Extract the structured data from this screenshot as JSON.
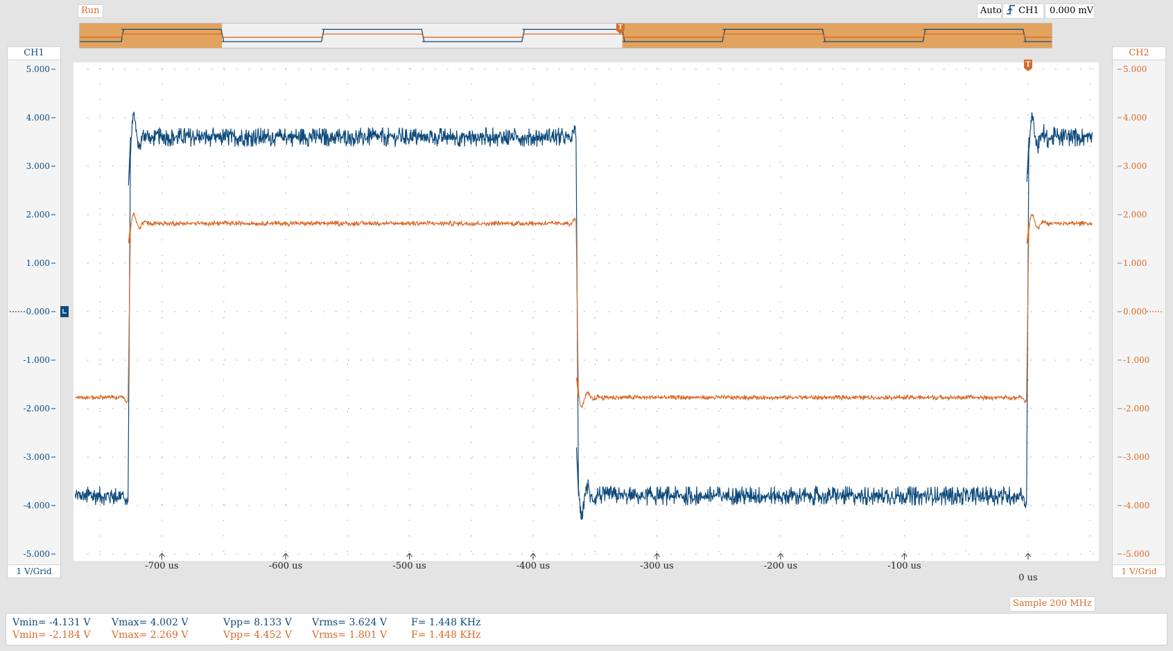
{
  "header": {
    "run_label": "Run",
    "trigger_mode": "Auto",
    "trigger_source": "CH1",
    "trigger_level": "0.000 mV",
    "trigger_marker": "T"
  },
  "ch1": {
    "name": "CH1",
    "scale": "1 V/Grid",
    "color": "#0e4a7c"
  },
  "ch2": {
    "name": "CH2",
    "scale": "1 V/Grid",
    "color": "#d86a2a"
  },
  "footer": {
    "sample_rate": "Sample 200 MHz"
  },
  "chart_data": {
    "type": "line",
    "title": "",
    "xlabel": "",
    "ylabel": "",
    "x_unit": "us",
    "xlim": [
      -770,
      50
    ],
    "ylim": [
      -5,
      5
    ],
    "x_ticks": [
      -700,
      -600,
      -500,
      -400,
      -300,
      -200,
      -100,
      0
    ],
    "x_tick_labels": [
      "-700 us",
      "-600 us",
      "-500 us",
      "-400 us",
      "-300 us",
      "-200 us",
      "-100 us",
      "0 us"
    ],
    "y_ticks": [
      5,
      4,
      3,
      2,
      1,
      0,
      -1,
      -2,
      -3,
      -4,
      -5
    ],
    "y_tick_labels": [
      "5.000",
      "4.000",
      "3.000",
      "2.000",
      "1.000",
      "0.000",
      "-1.000",
      "-2.000",
      "-3.000",
      "-4.000",
      "-5.000"
    ],
    "grid": true,
    "series": [
      {
        "name": "CH1",
        "color": "#0e4a7c",
        "waveform": "square",
        "high": 3.6,
        "low": -3.8,
        "noise": 0.2,
        "edges_us": [
          -727,
          -365,
          -1
        ],
        "x": [
          -770,
          -727,
          -365,
          -1,
          52
        ],
        "y": [
          -3.8,
          3.6,
          -3.8,
          3.6,
          3.6
        ]
      },
      {
        "name": "CH2",
        "color": "#d86a2a",
        "waveform": "square",
        "high": 1.82,
        "low": -1.77,
        "noise": 0.05,
        "edges_us": [
          -727,
          -365,
          -1
        ],
        "x": [
          -770,
          -727,
          -365,
          -1,
          52
        ],
        "y": [
          -1.77,
          1.82,
          -1.77,
          1.82,
          1.82
        ]
      }
    ]
  },
  "measurements": [
    {
      "channel": "CH1",
      "vmin": "Vmin= -4.131 V",
      "vmax": "Vmax= 4.002 V",
      "vpp": "Vpp= 8.133 V",
      "vrms": "Vrms= 3.624 V",
      "freq": "F= 1.448 KHz"
    },
    {
      "channel": "CH2",
      "vmin": "Vmin= -2.184 V",
      "vmax": "Vmax= 2.269 V",
      "vpp": "Vpp= 4.452 V",
      "vrms": "Vrms= 1.801 V",
      "freq": "F= 1.448 KHz"
    }
  ]
}
